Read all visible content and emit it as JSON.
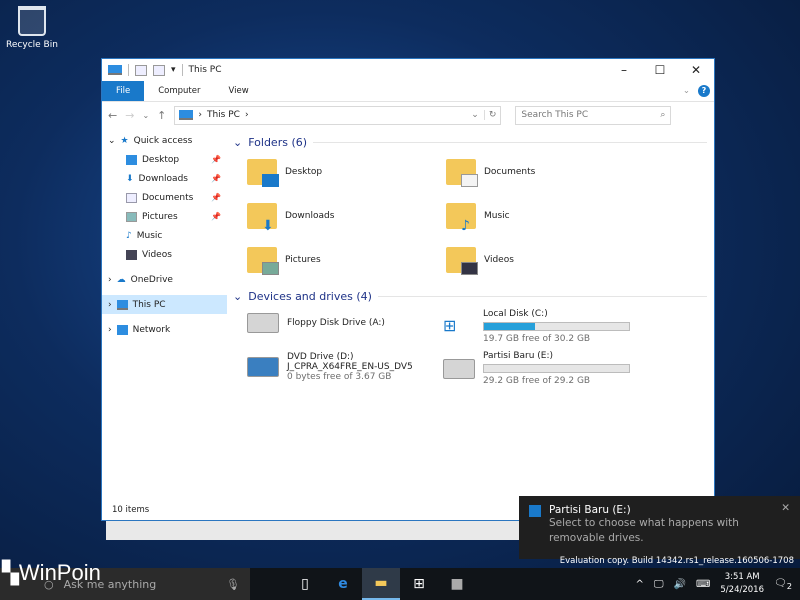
{
  "desktop": {
    "recycle_bin": "Recycle Bin"
  },
  "window": {
    "title": "This PC",
    "ribbon": {
      "tabs": [
        "File",
        "Computer",
        "View"
      ]
    },
    "address": {
      "crumbs": [
        "This PC"
      ],
      "search_placeholder": "Search This PC"
    },
    "nav": [
      {
        "label": "Quick access",
        "icon": "star-icon"
      },
      {
        "label": "Desktop",
        "pinned": true
      },
      {
        "label": "Downloads",
        "pinned": true
      },
      {
        "label": "Documents",
        "pinned": true
      },
      {
        "label": "Pictures",
        "pinned": true
      },
      {
        "label": "Music"
      },
      {
        "label": "Videos"
      },
      {
        "label": "OneDrive"
      },
      {
        "label": "This PC",
        "selected": true
      },
      {
        "label": "Network"
      }
    ],
    "folders_header": "Folders (6)",
    "folders": [
      "Desktop",
      "Documents",
      "Downloads",
      "Music",
      "Pictures",
      "Videos"
    ],
    "drives_header": "Devices and drives (4)",
    "drives": [
      {
        "name": "Floppy Disk Drive (A:)"
      },
      {
        "name": "Local Disk (C:)",
        "free": "19.7 GB free of 30.2 GB",
        "used_fraction": 0.35
      },
      {
        "name": "DVD Drive (D:)",
        "label": "J_CPRA_X64FRE_EN-US_DV5",
        "free": "0 bytes free of 3.67 GB"
      },
      {
        "name": "Partisi Baru (E:)",
        "free": "29.2 GB free of 29.2 GB",
        "used_fraction": 0.0
      }
    ],
    "status": "10 items"
  },
  "toast": {
    "title": "Partisi Baru (E:)",
    "body": "Select to choose what happens with removable drives."
  },
  "watermark": "Evaluation copy. Build 14342.rs1_release.160506-1708",
  "taskbar": {
    "search_placeholder": "Ask me anything",
    "time": "3:51 AM",
    "date": "5/24/2016",
    "notifications": "2"
  },
  "logo": "WinPoin"
}
